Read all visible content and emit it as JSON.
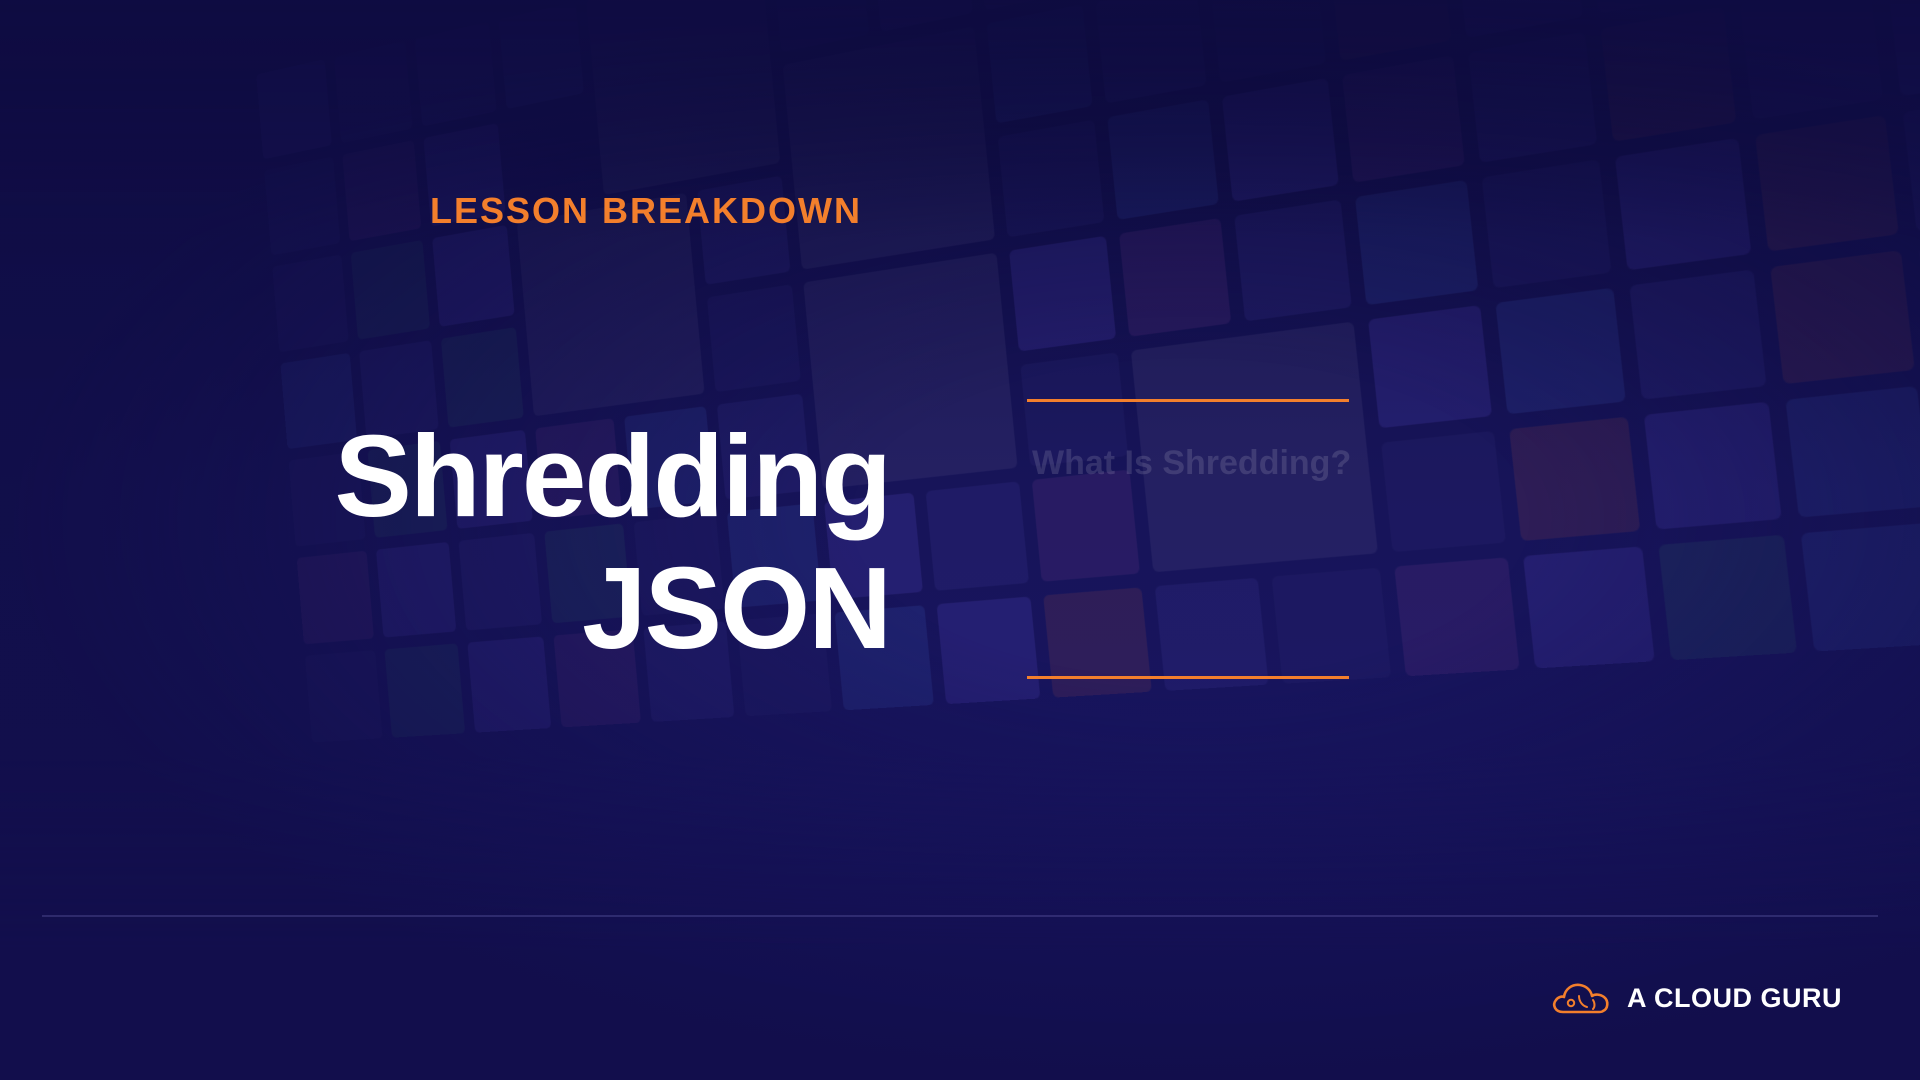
{
  "slide": {
    "kicker": "LESSON BREAKDOWN",
    "title_lines": [
      "Shredding",
      "JSON"
    ],
    "subtitle": "What Is Shredding?"
  },
  "brand": {
    "name": "A CLOUD GURU",
    "logo_icon": "cloud-logo-icon"
  },
  "colors": {
    "accent": "#f37f2c",
    "background_top": "#0c0a3a",
    "background_bottom": "#1a1664",
    "title_text": "#ffffff"
  }
}
